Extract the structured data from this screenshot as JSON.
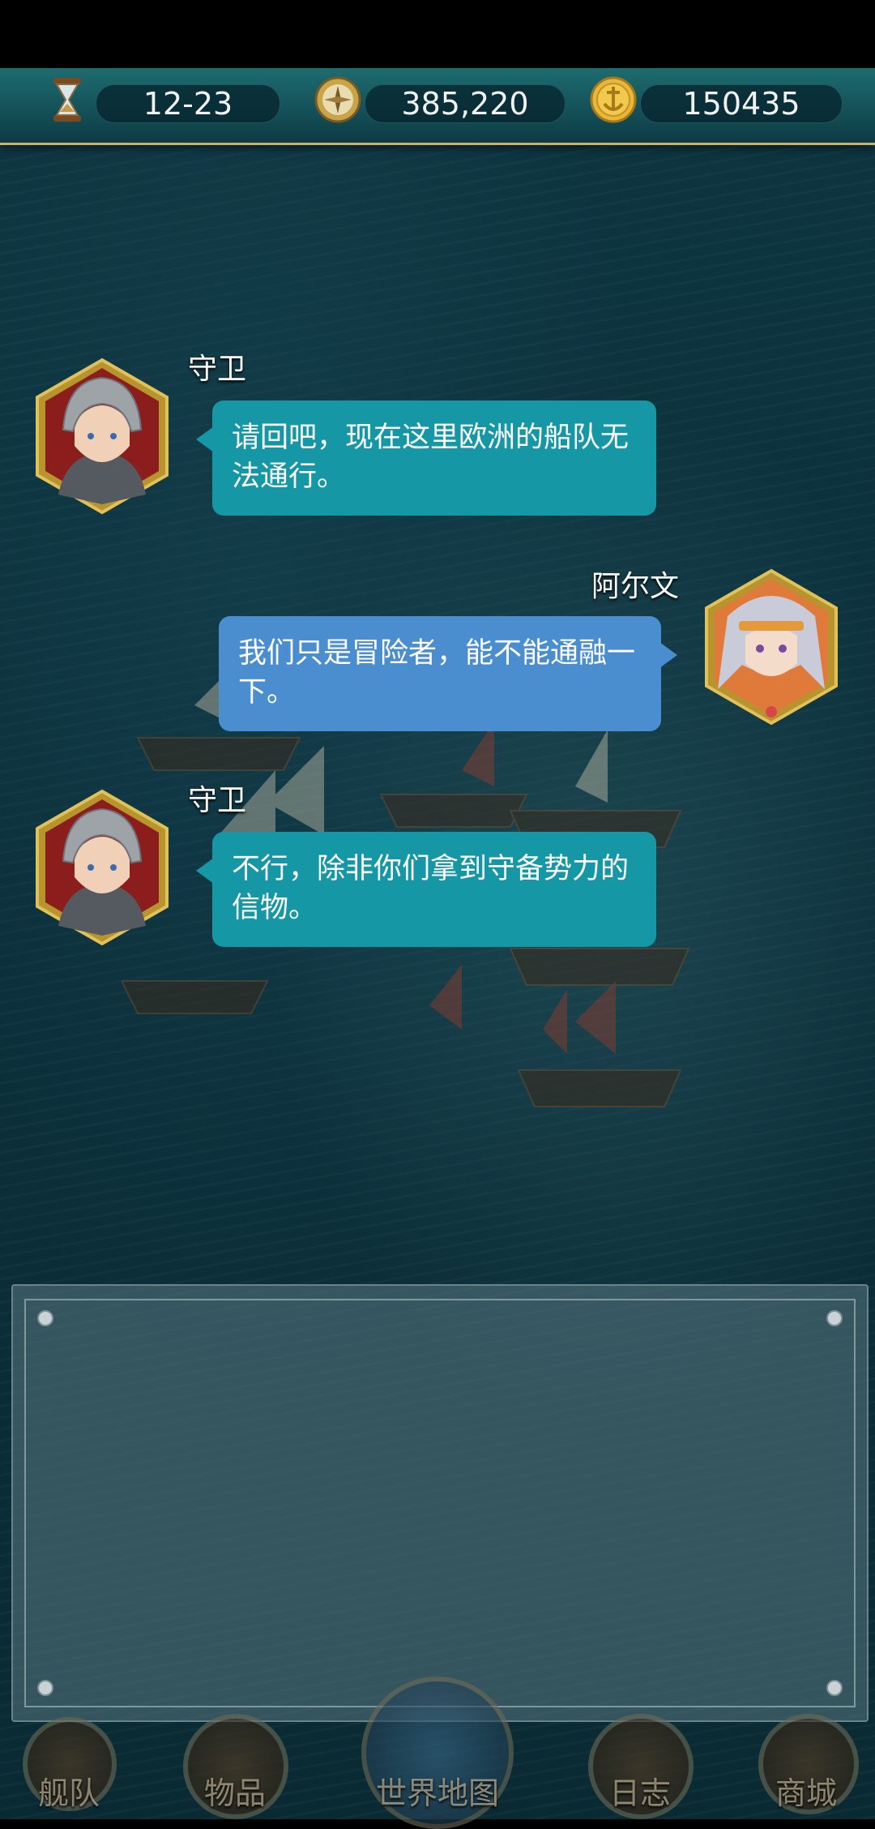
{
  "topbar": {
    "date": "12-23",
    "compass_value": "385,220",
    "gold": "150435",
    "icons": [
      "hourglass-icon",
      "compass-icon",
      "anchor-coin-icon"
    ]
  },
  "dialogue": [
    {
      "speaker": "守卫",
      "text": "请回吧，现在这里欧洲的船队无法通行。",
      "side": "left"
    },
    {
      "speaker": "阿尔文",
      "text": "我们只是冒险者，能不能通融一下。",
      "side": "right"
    },
    {
      "speaker": "守卫",
      "text": "不行，除非你们拿到守备势力的信物。",
      "side": "left"
    }
  ],
  "nav": {
    "fleet": "舰队",
    "items": "物品",
    "world_map": "世界地图",
    "log": "日志",
    "shop": "商城"
  },
  "colors": {
    "teal_bubble": "#1697a6",
    "blue_bubble": "#4a8ed0",
    "sea": "#0b2f3a"
  }
}
